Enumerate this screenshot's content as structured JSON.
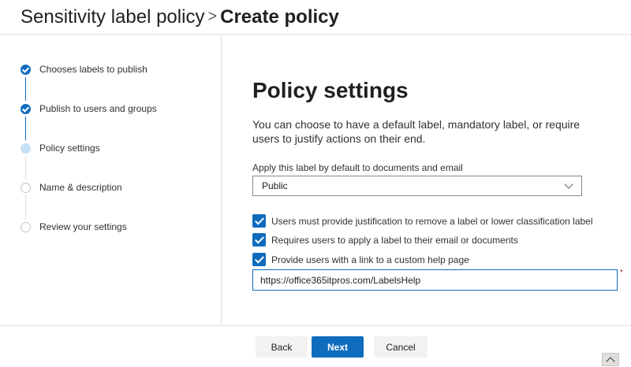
{
  "header": {
    "parent": "Sensitivity label policy",
    "separator": ">",
    "current": "Create policy"
  },
  "steps": [
    {
      "label": "Chooses labels to publish",
      "state": "done"
    },
    {
      "label": "Publish to users and groups",
      "state": "done"
    },
    {
      "label": "Policy settings",
      "state": "current"
    },
    {
      "label": "Name & description",
      "state": "todo"
    },
    {
      "label": "Review your settings",
      "state": "todo"
    }
  ],
  "main": {
    "title": "Policy settings",
    "description": "You can choose to have a default label, mandatory label, or require users to justify actions on their end.",
    "dropdown": {
      "label": "Apply this label by default to documents and email",
      "value": "Public",
      "icon": "chevron-down-icon"
    },
    "checkboxes": [
      {
        "label": "Users must provide justification to remove a label or lower classification label",
        "checked": true
      },
      {
        "label": "Requires users to apply a label to their email or documents",
        "checked": true
      },
      {
        "label": "Provide users with a link to a custom help page",
        "checked": true
      }
    ],
    "help_url": {
      "value": "https://office365itpros.com/LabelsHelp",
      "required_mark": "*"
    }
  },
  "footer": {
    "back_label": "Back",
    "next_label": "Next",
    "cancel_label": "Cancel"
  },
  "colors": {
    "accent": "#0f6cbd",
    "current_step": "#c7e0f4",
    "border": "#e1dfdd"
  }
}
